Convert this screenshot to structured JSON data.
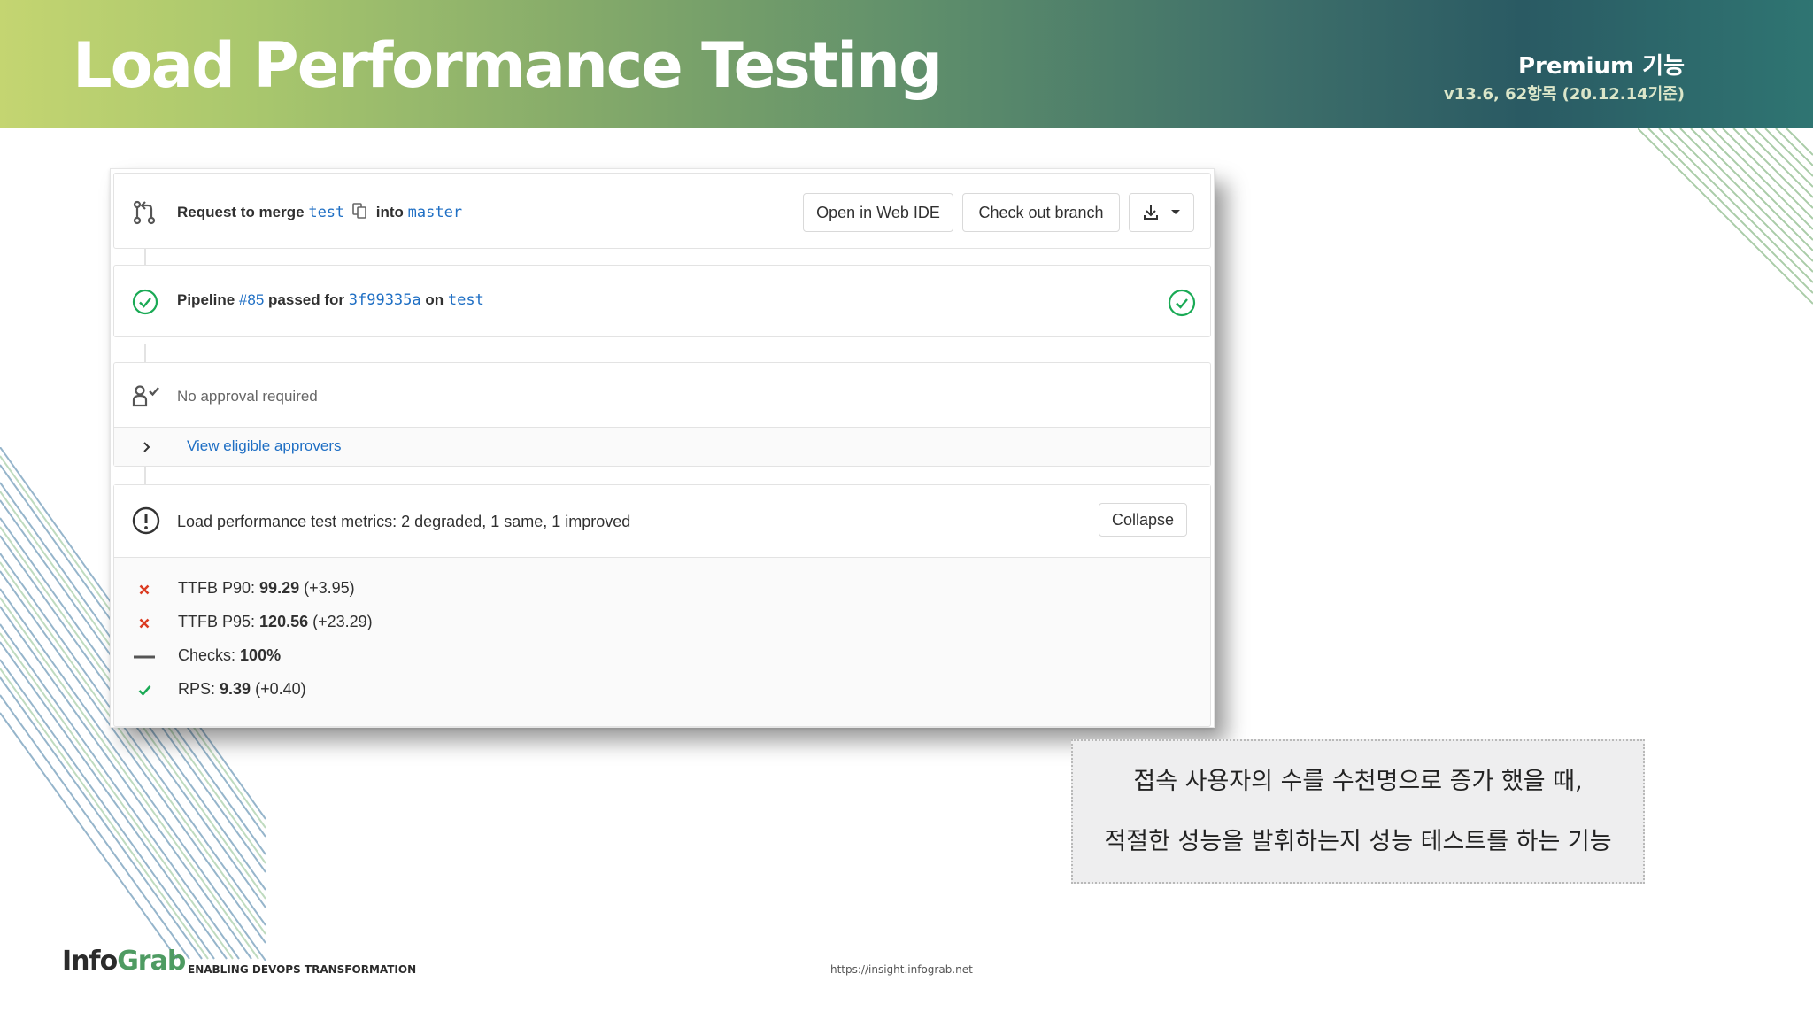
{
  "slide": {
    "title": "Load Performance Testing",
    "badge": "Premium 기능",
    "version": "v13.6, 62항목 (20.12.14기준)"
  },
  "merge_request": {
    "header": {
      "prefix": "Request to merge",
      "source_branch": "test",
      "into_text": "into",
      "target_branch": "master",
      "open_web_ide_label": "Open in Web IDE",
      "checkout_label": "Check out branch"
    },
    "pipeline": {
      "prefix": "Pipeline",
      "id": "#85",
      "passed_text": "passed for",
      "commit": "3f99335a",
      "on_text": "on",
      "branch": "test"
    },
    "approval": {
      "status": "No approval required",
      "approvers_link": "View eligible approvers"
    },
    "metrics": {
      "summary": "Load performance test metrics: 2 degraded, 1 same, 1 improved",
      "collapse_label": "Collapse",
      "items": [
        {
          "status": "degraded",
          "label": "TTFB P90:",
          "value": "99.29",
          "delta": "(+3.95)"
        },
        {
          "status": "degraded",
          "label": "TTFB P95:",
          "value": "120.56",
          "delta": "(+23.29)"
        },
        {
          "status": "same",
          "label": "Checks:",
          "value": "100%",
          "delta": ""
        },
        {
          "status": "improved",
          "label": "RPS:",
          "value": "9.39",
          "delta": "(+0.40)"
        }
      ]
    }
  },
  "description": {
    "line1": "접속 사용자의 수를 수천명으로 증가 했을 때,",
    "line2": "적절한 성능을 발휘하는지 성능 테스트를 하는 기능"
  },
  "footer": {
    "logo_part1": "Info",
    "logo_part2": "Grab",
    "tagline": "ENABLING DEVOPS TRANSFORMATION",
    "url": "https://insight.infograb.net"
  },
  "colors": {
    "link_blue": "#1f6fc4",
    "success_green": "#1aaa55",
    "degraded_red": "#db3b21",
    "brand_green": "#4e9b62"
  }
}
